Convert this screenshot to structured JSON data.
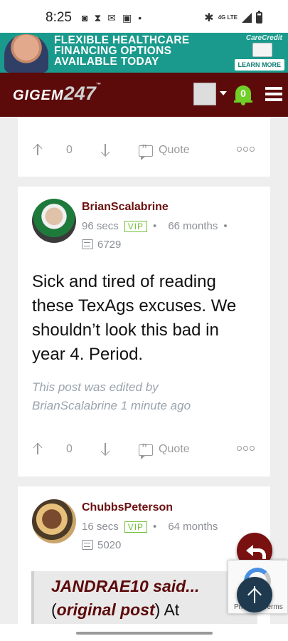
{
  "status_bar": {
    "time": "8:25",
    "network": "4G LTE"
  },
  "ad": {
    "headline_line1": "FLEXIBLE HEALTHCARE",
    "headline_line2": "FINANCING OPTIONS",
    "headline_line3": "AVAILABLE TODAY",
    "brand": "CareCredit",
    "cta": "LEARN MORE"
  },
  "header": {
    "logo_text": "GIGEM",
    "logo_num": "247",
    "logo_tm": "™",
    "notification_count": "0"
  },
  "post0": {
    "upvotes": "0",
    "quote_label": "Quote"
  },
  "post1": {
    "username": "BrianScalabrine",
    "time_ago": "96 secs",
    "badge": "VIP",
    "separator": "•",
    "member_for": "66 months",
    "post_count": "6729",
    "body": "Sick and tired of reading these TexAgs excuses. We shouldn’t look this bad in year 4. Period.",
    "edited": "This post was edited by BrianScalabrine 1 minute ago",
    "upvotes": "0",
    "quote_label": "Quote"
  },
  "post2": {
    "username": "ChubbsPeterson",
    "time_ago": "16 secs",
    "badge": "VIP",
    "separator": "•",
    "member_for": "64 months",
    "post_count": "5020",
    "quote_author": "JANDRAE10 said...",
    "quote_source_link": "original post",
    "quote_source_rest": ") At",
    "quote_source_open": "("
  },
  "recaptcha": {
    "text": "Privacy - Terms"
  }
}
